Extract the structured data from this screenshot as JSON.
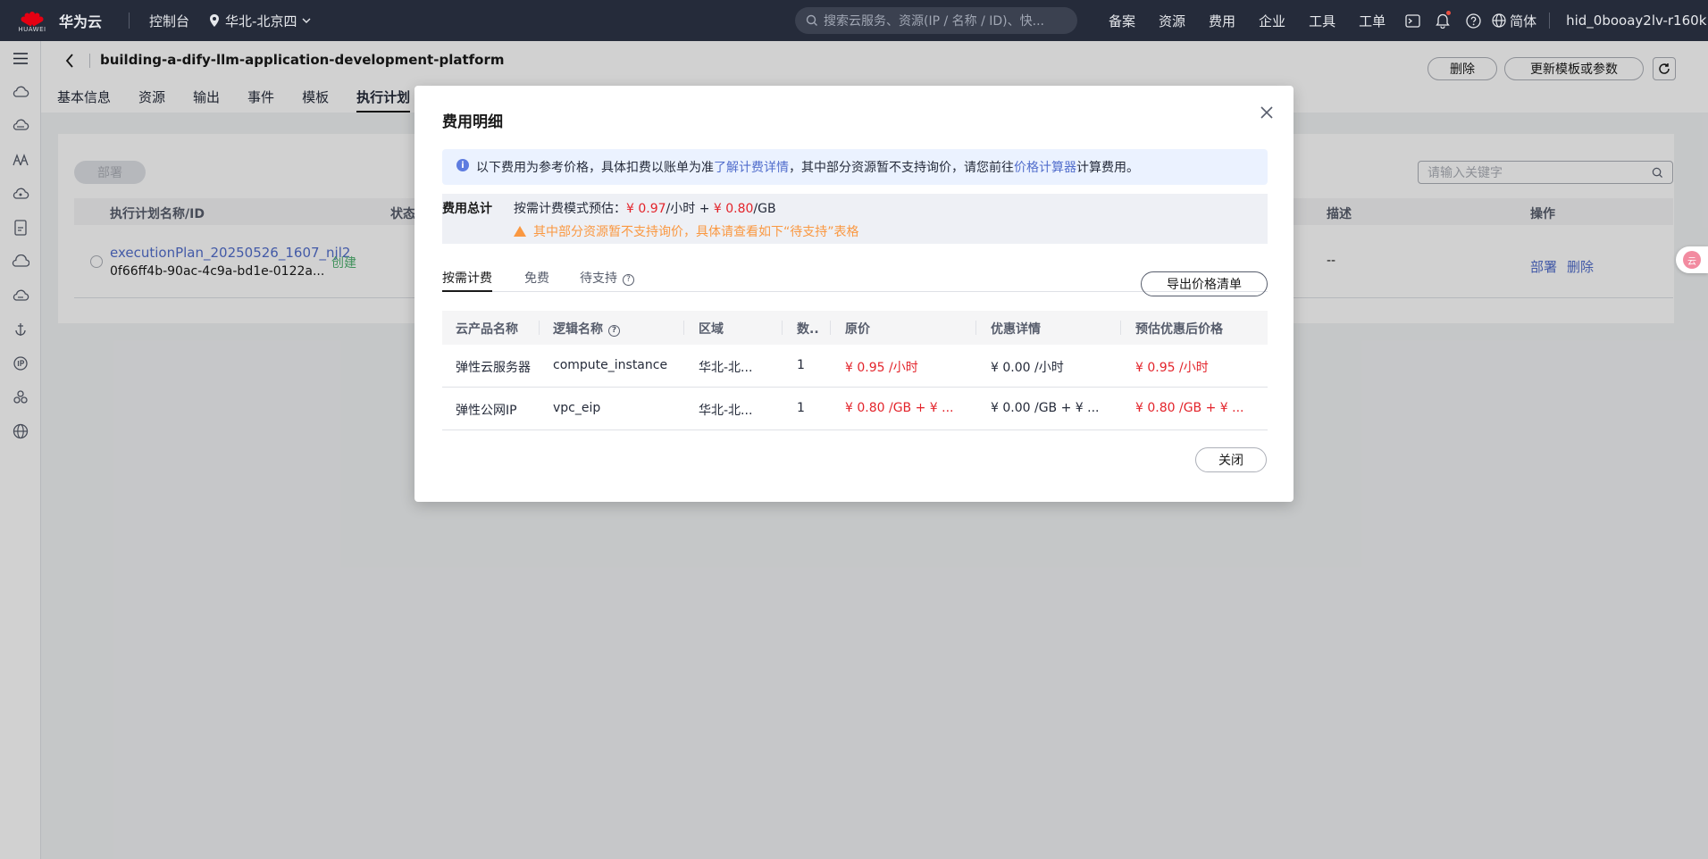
{
  "topbar": {
    "brand": "华为云",
    "logo_text": "HUAWEI",
    "console": "控制台",
    "region": "华北-北京四",
    "search_placeholder": "搜索云服务、资源(IP / 名称 / ID)、快...",
    "links": [
      "备案",
      "资源",
      "费用",
      "企业",
      "工具",
      "工单"
    ],
    "language": "简体",
    "user": "hid_0booay2lv-r160k"
  },
  "sidebar": {
    "icons": [
      "menu-icon",
      "cloud-icon",
      "cloud-storage-icon",
      "network-icon",
      "cloud-service-icon",
      "document-icon",
      "cloud-outline-icon",
      "cloud-server-icon",
      "anchor-icon",
      "ip-icon",
      "cluster-icon",
      "globe-icon"
    ]
  },
  "header": {
    "title": "building-a-dify-llm-application-development-platform",
    "tabs": [
      "基本信息",
      "资源",
      "输出",
      "事件",
      "模板",
      "执行计划"
    ],
    "active_tab": 5,
    "delete_label": "删除",
    "update_label": "更新模板或参数"
  },
  "plans": {
    "deploy_label": "部署",
    "search_placeholder": "请输入关键字",
    "columns": {
      "name": "执行计划名称/ID",
      "status": "状态",
      "desc": "描述",
      "ops": "操作"
    },
    "row": {
      "name": "executionPlan_20250526_1607_njl2",
      "id": "0f66ff4b-90ac-4c9a-bd1e-0122a...",
      "status": "创建",
      "desc": "--",
      "op_deploy": "部署",
      "op_delete": "删除"
    }
  },
  "float_badge": "云",
  "modal": {
    "title": "费用明细",
    "info": {
      "text1": "以下费用为参考价格，具体扣费以账单为准",
      "link1": "了解计费详情",
      "text2": "，其中部分资源暂不支持询价，请您前往",
      "link2": "价格计算器",
      "text3": "计算费用。"
    },
    "total": {
      "label": "费用总计",
      "prefix": "按需计费模式预估：",
      "price_hour": "¥ 0.97",
      "unit_hour": "/小时 + ",
      "price_gb": "¥ 0.80",
      "unit_gb": "/GB",
      "warning": "其中部分资源暂不支持询价，具体请查看如下“待支持”表格"
    },
    "tabs": [
      "按需计费",
      "免费",
      "待支持"
    ],
    "active_tab": 0,
    "export_label": "导出价格清单",
    "table": {
      "headers": [
        "云产品名称",
        "逻辑名称",
        "区域",
        "数..",
        "原价",
        "优惠详情",
        "预估优惠后价格"
      ],
      "rows": [
        {
          "product": "弹性云服务器",
          "logical": "compute_instance",
          "region": "华北-北...",
          "qty": "1",
          "price": "¥ 0.95 /小时",
          "discount": "¥ 0.00 /小时",
          "final": "¥ 0.95 /小时"
        },
        {
          "product": "弹性公网IP",
          "logical": "vpc_eip",
          "region": "华北-北...",
          "qty": "1",
          "price": "¥ 0.80 /GB + ¥ ...",
          "discount": "¥ 0.00 /GB + ¥ ...",
          "final": "¥ 0.80 /GB + ¥ ..."
        }
      ]
    },
    "close_label": "关闭"
  }
}
